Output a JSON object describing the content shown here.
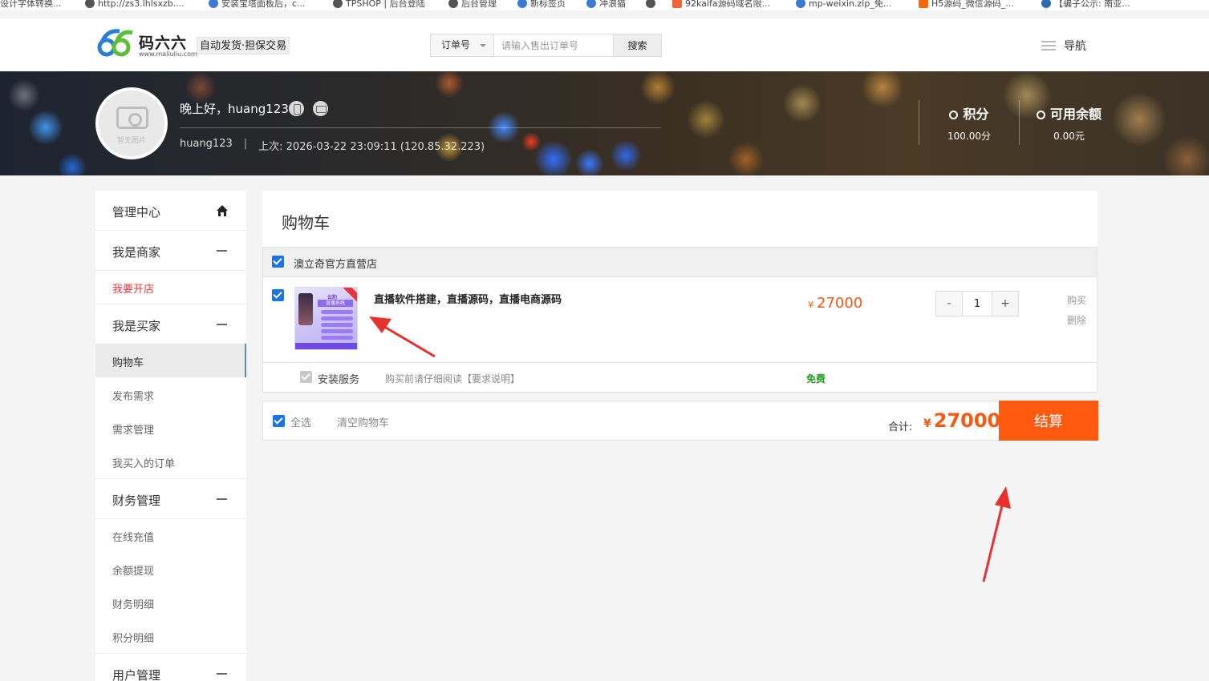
{
  "bookmarks": [
    {
      "label": "设计字体转换..."
    },
    {
      "label": "http://zs3.lhlsxzb...."
    },
    {
      "label": "安装宝塔面板后，c..."
    },
    {
      "label": "TPSHOP | 后台登陆"
    },
    {
      "label": "后台管理"
    },
    {
      "label": "新标签页"
    },
    {
      "label": "冲浪猫"
    },
    {
      "label": ""
    },
    {
      "label": "92kaifa源码域名限..."
    },
    {
      "label": "mp-weixin.zip_免..."
    },
    {
      "label": "H5源码_微信源码_..."
    },
    {
      "label": "【骗子公示: 南亚..."
    }
  ],
  "header": {
    "logo_text": "码六六",
    "logo_url": "www.maliuliu.com",
    "slogan": "自动发货·担保交易",
    "search_type": "订单号",
    "search_placeholder": "请输入售出订单号",
    "search_button": "搜索",
    "nav_label": "导航"
  },
  "banner": {
    "avatar_caption": "暂无图片",
    "greeting": "晚上好，huang123",
    "username": "huang123",
    "separator": "|",
    "last_login": "上次: 2026-03-22 23:09:11 (120.85.32.223)",
    "points_label": "积分",
    "points_value": "100.00分",
    "balance_label": "可用余额",
    "balance_value": "0.00元"
  },
  "sidebar": {
    "management_center": "管理中心",
    "sections": [
      {
        "title": "我是商家",
        "items": [
          "我要开店"
        ]
      },
      {
        "title": "我是买家",
        "items": [
          "购物车",
          "发布需求",
          "需求管理",
          "我买入的订单"
        ]
      },
      {
        "title": "财务管理",
        "items": [
          "在线充值",
          "余额提现",
          "财务明细",
          "积分明细"
        ]
      },
      {
        "title": "用户管理",
        "items": []
      }
    ]
  },
  "cart": {
    "title": "购物车",
    "shop_name": "澳立奇官方直营店",
    "item": {
      "name": "直播软件搭建，直播源码，直播电商源码",
      "currency": "¥",
      "price": "27000",
      "quantity": "1",
      "minus": "-",
      "plus": "+",
      "buy": "购买",
      "delete": "删除",
      "thumb_text_1": "云豹",
      "thumb_text_2": "直播系统"
    },
    "service": {
      "name": "安装服务",
      "note": "购买前请仔细阅读【要求说明】",
      "price": "免费"
    },
    "footer": {
      "select_all": "全选",
      "clear": "清空购物车",
      "total_label": "合计:",
      "currency": "¥",
      "total": "27000",
      "checkout": "结算"
    }
  },
  "colors": {
    "accent_orange": "#ff5a0f",
    "price_orange": "#f45a14",
    "checkbox_blue": "#1a73e8",
    "free_green": "#1f9e1f",
    "annotation_red": "#e8312c"
  }
}
